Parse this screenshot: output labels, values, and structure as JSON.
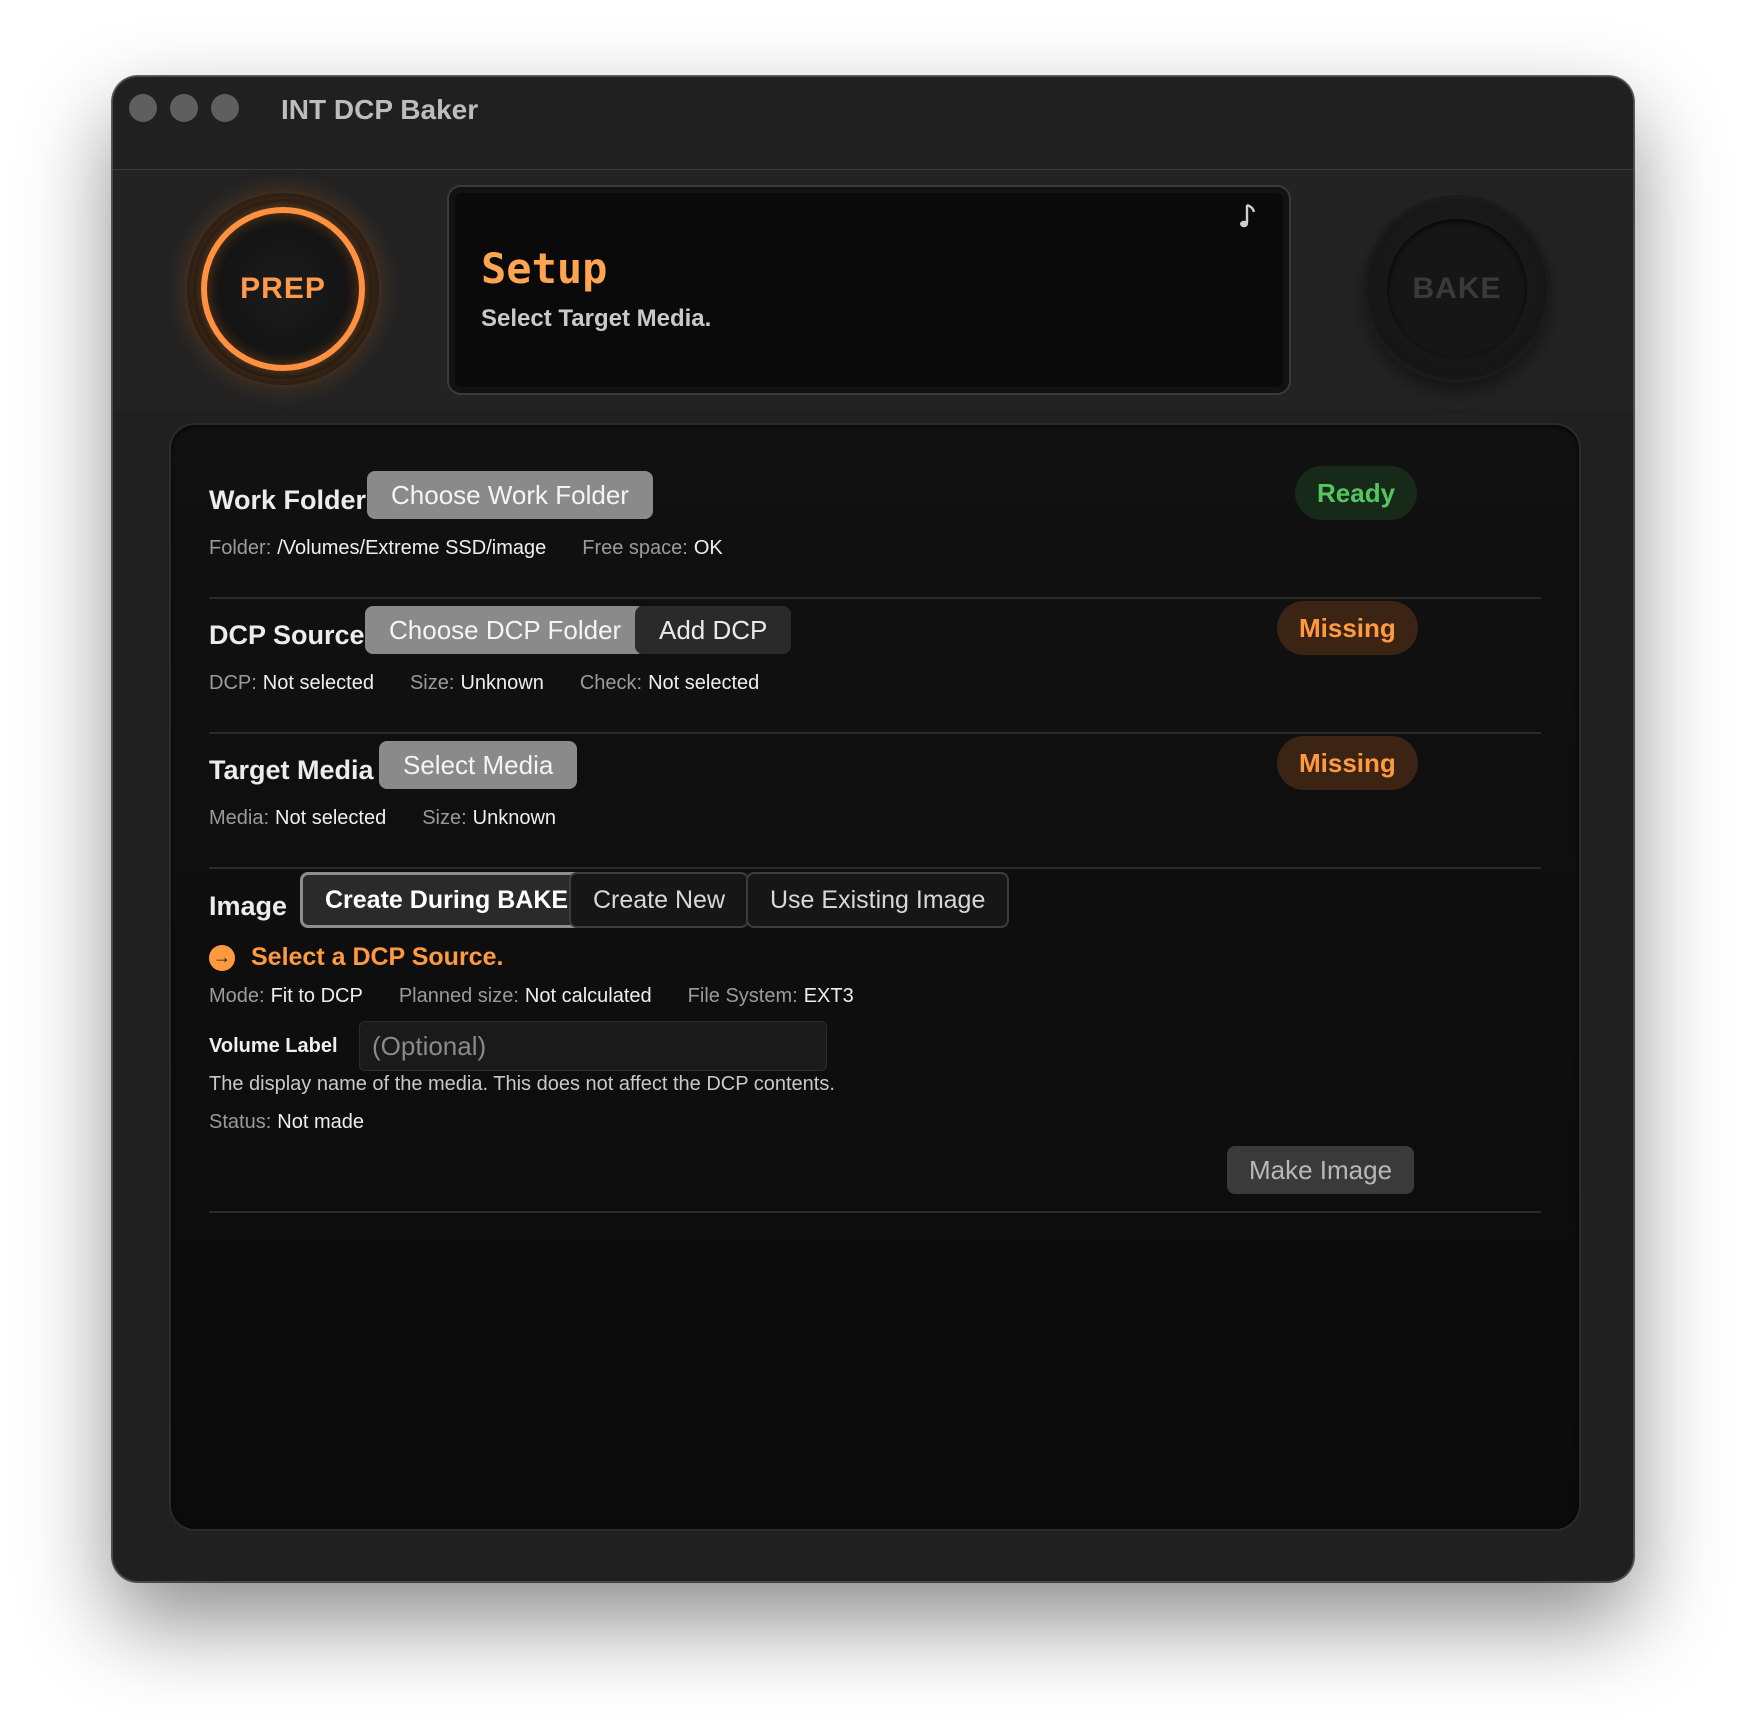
{
  "window": {
    "title": "INT DCP Baker"
  },
  "header": {
    "prep_label": "PREP",
    "bake_label": "BAKE",
    "display_title": "Setup",
    "display_subtitle": "Select Target Media."
  },
  "work_folder": {
    "title": "Work Folder",
    "button": "Choose Work Folder",
    "badge": "Ready",
    "folder_label": "Folder:",
    "folder_value": "/Volumes/Extreme SSD/image",
    "free_label": "Free space:",
    "free_value": "OK"
  },
  "dcp_source": {
    "title": "DCP Source",
    "choose_button": "Choose DCP Folder",
    "add_button": "Add DCP",
    "badge": "Missing",
    "dcp_label": "DCP:",
    "dcp_value": "Not selected",
    "size_label": "Size:",
    "size_value": "Unknown",
    "check_label": "Check:",
    "check_value": "Not selected"
  },
  "target_media": {
    "title": "Target Media",
    "button": "Select Media",
    "badge": "Missing",
    "media_label": "Media:",
    "media_value": "Not selected",
    "size_label": "Size:",
    "size_value": "Unknown"
  },
  "image": {
    "title": "Image",
    "options": [
      "Create During BAKE",
      "Create New",
      "Use Existing Image"
    ],
    "selected_option": "Create During BAKE",
    "hint": "Select a DCP Source.",
    "mode_label": "Mode:",
    "mode_value": "Fit to DCP",
    "planned_label": "Planned size:",
    "planned_value": "Not calculated",
    "fs_label": "File System:",
    "fs_value": "EXT3",
    "volume_label": "Volume Label",
    "volume_placeholder": "(Optional)",
    "volume_value": "",
    "volume_desc": "The display name of the media. This does not affect the DCP contents.",
    "status_label": "Status:",
    "status_value": "Not made",
    "make_button": "Make Image"
  },
  "colors": {
    "accent": "#ff9a3e",
    "ready": "#55c65f",
    "window_bg": "#202020",
    "panel_bg": "#0d0d0d"
  },
  "icons": [
    "music-note-icon",
    "arrow-right-circle-icon"
  ]
}
